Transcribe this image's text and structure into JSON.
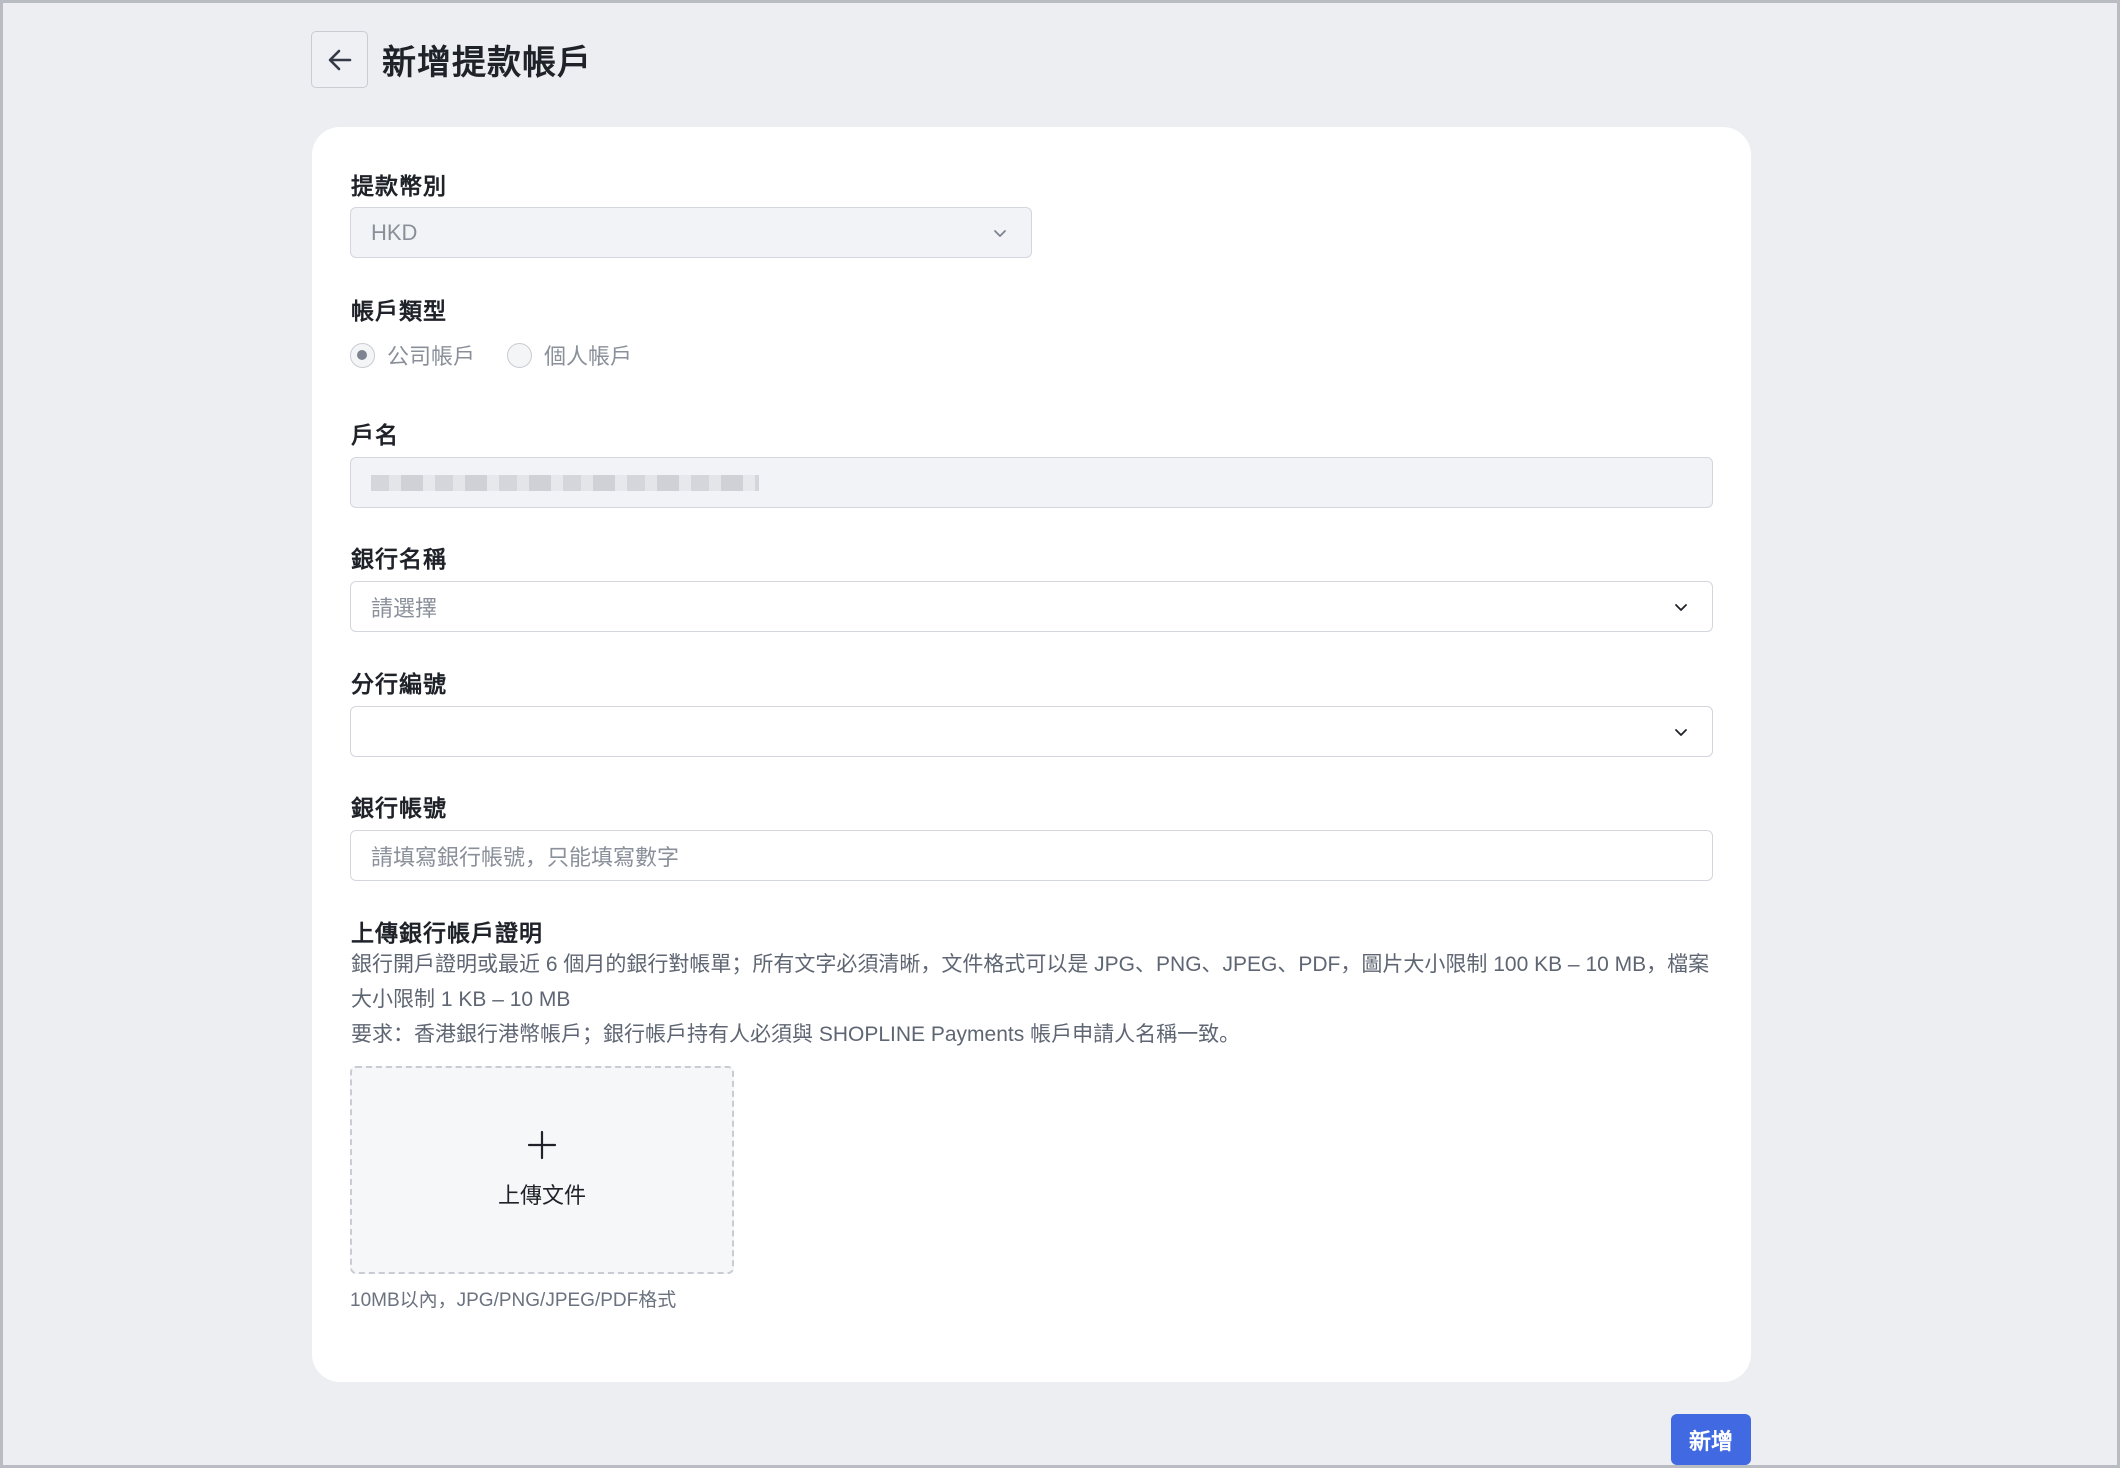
{
  "header": {
    "title": "新增提款帳戶"
  },
  "form": {
    "currency": {
      "label": "提款幣別",
      "value": "HKD"
    },
    "account_type": {
      "label": "帳戶類型",
      "options": [
        {
          "label": "公司帳戶",
          "selected": true
        },
        {
          "label": "個人帳戶",
          "selected": false
        }
      ]
    },
    "account_name": {
      "label": "戶名",
      "value": ""
    },
    "bank_name": {
      "label": "銀行名稱",
      "placeholder": "請選擇"
    },
    "branch_code": {
      "label": "分行編號",
      "value": ""
    },
    "account_number": {
      "label": "銀行帳號",
      "placeholder": "請填寫銀行帳號，只能填寫數字"
    },
    "proof": {
      "label": "上傳銀行帳戶證明",
      "description_1": "銀行開戶證明或最近 6 個月的銀行對帳單；所有文字必須清晰，文件格式可以是 JPG、PNG、JPEG、PDF，圖片大小限制 100 KB – 10 MB，檔案大小限制 1 KB – 10 MB",
      "description_2": "要求：香港銀行港幣帳戶；銀行帳戶持有人必須與 SHOPLINE Payments 帳戶申請人名稱一致。",
      "upload_label": "上傳文件",
      "hint": "10MB以內，JPG/PNG/JPEG/PDF格式"
    }
  },
  "actions": {
    "submit_label": "新增"
  },
  "colors": {
    "primary": "#4169e1",
    "background": "#eceef2",
    "card": "#ffffff"
  }
}
